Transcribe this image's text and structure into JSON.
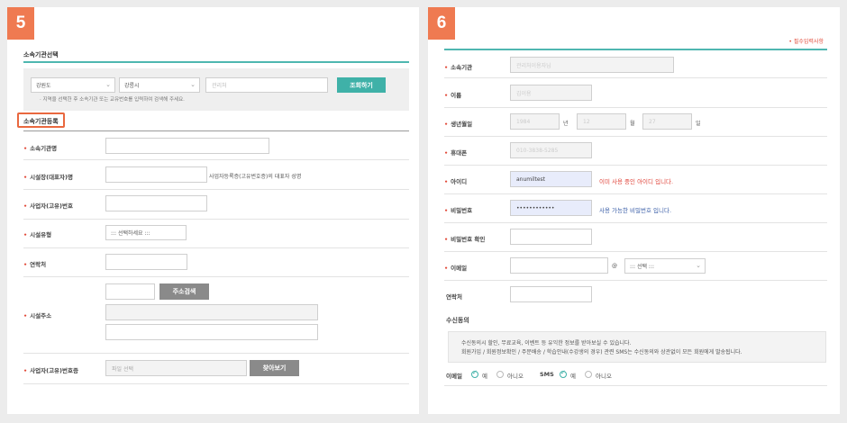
{
  "left": {
    "step": "5",
    "section_title": "소속기관선택",
    "search": {
      "province": "강원도",
      "city": "강릉시",
      "keyword_placeholder": "관리처",
      "button": "조회하기",
      "hint": "· 지역을 선택한 후 소속기관 또는 교유번호를 입력하여 검색해 주세요."
    },
    "register_title": "소속기관등록",
    "fields": {
      "org_name": "소속기관명",
      "rep_name": "시설장(대표자)명",
      "rep_note": "사업자등록증(고유번호증)의 대표자 성명",
      "biz_no": "사업자(고유)번호",
      "facility_type": "시설유형",
      "facility_type_value": "::: 선택하세요 :::",
      "contact": "연락처",
      "address": "시설주소",
      "address_button": "주소검색",
      "cert": "사업자(고유)번호증",
      "cert_placeholder": "파일 선택",
      "cert_button": "찾아보기"
    }
  },
  "right": {
    "step": "6",
    "required_note": "• 필수입력사항",
    "fields": {
      "org": "소속기관",
      "org_value": "관리처이용자님",
      "name": "이름",
      "name_value": "김이용",
      "birth": "생년월일",
      "birth_year": "1984",
      "year_unit": "년",
      "birth_month": "12",
      "month_unit": "월",
      "birth_day": "27",
      "day_unit": "일",
      "mobile": "휴대폰",
      "mobile_value": "010-3838-5285",
      "user_id": "아이디",
      "user_id_value": "anumiltest",
      "id_msg": "이미 사용 중인 아이디 입니다.",
      "password": "비밀번호",
      "password_value": "••••••••••••",
      "pw_msg": "사용 가능한 비밀번호 입니다.",
      "pw_confirm": "비밀번호 확인",
      "email": "이메일",
      "at": "@",
      "email_domain": "::: 선택 :::",
      "contact": "연락처"
    },
    "consent": {
      "title": "수신동의",
      "line1": "수신동의시 할인, 무료교육, 이벤트 등 유익한 정보를 받아보실 수 있습니다.",
      "line2": "회원가입 / 회원정보확인 / 주문배송 / 학습안내(수강생의 경우) 관련 SMS는 수신동의와 상관없이 모든 회원에게 발송됩니다.",
      "email_label": "이메일",
      "sms_label": "SMS",
      "yes": "예",
      "no": "아니오"
    }
  }
}
